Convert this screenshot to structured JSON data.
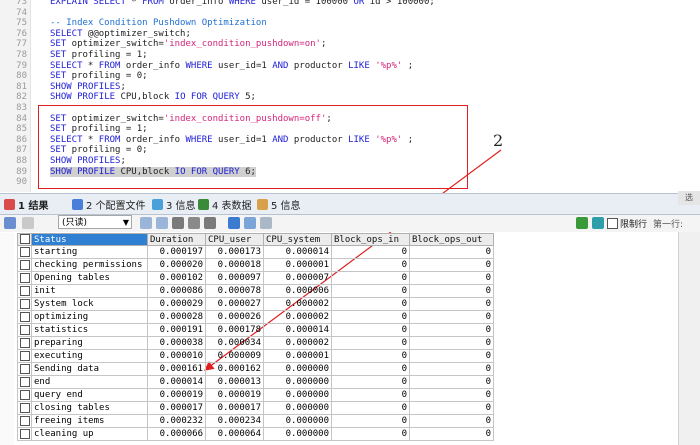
{
  "editor": {
    "lines": [
      {
        "n": "73",
        "code": "EXPLAIN SELECT * FROM order_info WHERE user_id = 100000 OR id > 100000;"
      },
      {
        "n": "74",
        "code": ""
      },
      {
        "n": "75",
        "code": "-- Index Condition Pushdown Optimization"
      },
      {
        "n": "76",
        "code": "SELECT @@optimizer_switch;"
      },
      {
        "n": "77",
        "code": "SET optimizer_switch='index_condition_pushdown=on';"
      },
      {
        "n": "78",
        "code": "SET profiling = 1;"
      },
      {
        "n": "79",
        "code": "SELECT * FROM order_info WHERE user_id=1 AND productor LIKE '%p%' ;"
      },
      {
        "n": "80",
        "code": "SET profiling = 0;"
      },
      {
        "n": "81",
        "code": "SHOW PROFILES;"
      },
      {
        "n": "82",
        "code": "SHOW PROFILE CPU,block IO FOR QUERY 5;"
      },
      {
        "n": "83",
        "code": ""
      },
      {
        "n": "84",
        "code": "SET optimizer_switch='index_condition_pushdown=off';"
      },
      {
        "n": "85",
        "code": "SET profiling = 1;"
      },
      {
        "n": "86",
        "code": "SELECT * FROM order_info WHERE user_id=1 AND productor LIKE '%p%' ;"
      },
      {
        "n": "87",
        "code": "SET profiling = 0;"
      },
      {
        "n": "88",
        "code": "SHOW PROFILES;"
      },
      {
        "n": "89",
        "code": "SHOW PROFILE CPU,block IO FOR QUERY 6;"
      },
      {
        "n": "90",
        "code": ""
      }
    ],
    "callout_label": "2"
  },
  "tabs": [
    {
      "label": "1 结果",
      "color": "#d94a4a"
    },
    {
      "label": "2 个配置文件",
      "color": "#4a7fd9"
    },
    {
      "label": "3 信息",
      "color": "#4aa0d9"
    },
    {
      "label": "4 表数据",
      "color": "#3a8a3a"
    },
    {
      "label": "5 信息",
      "color": "#d9a04a"
    }
  ],
  "toolbar": {
    "mode_value": "(只读)",
    "limit_label": "限制行",
    "first_row_label": "第一行:",
    "right_corner_text": "选"
  },
  "grid": {
    "columns": [
      "Status",
      "Duration",
      "CPU_user",
      "CPU_system",
      "Block_ops_in",
      "Block_ops_out"
    ],
    "rows": [
      [
        "starting",
        "0.000197",
        "0.000173",
        "0.000014",
        "0",
        "0"
      ],
      [
        "checking permissions",
        "0.000020",
        "0.000018",
        "0.000001",
        "0",
        "0"
      ],
      [
        "Opening tables",
        "0.000102",
        "0.000097",
        "0.000007",
        "0",
        "0"
      ],
      [
        "init",
        "0.000086",
        "0.000078",
        "0.000006",
        "0",
        "0"
      ],
      [
        "System lock",
        "0.000029",
        "0.000027",
        "0.000002",
        "0",
        "0"
      ],
      [
        "optimizing",
        "0.000028",
        "0.000026",
        "0.000002",
        "0",
        "0"
      ],
      [
        "statistics",
        "0.000191",
        "0.000178",
        "0.000014",
        "0",
        "0"
      ],
      [
        "preparing",
        "0.000038",
        "0.000034",
        "0.000002",
        "0",
        "0"
      ],
      [
        "executing",
        "0.000010",
        "0.000009",
        "0.000001",
        "0",
        "0"
      ],
      [
        "Sending data",
        "0.000161",
        "0.000162",
        "0.000000",
        "0",
        "0"
      ],
      [
        "end",
        "0.000014",
        "0.000013",
        "0.000000",
        "0",
        "0"
      ],
      [
        "query end",
        "0.000019",
        "0.000019",
        "0.000000",
        "0",
        "0"
      ],
      [
        "closing tables",
        "0.000017",
        "0.000017",
        "0.000000",
        "0",
        "0"
      ],
      [
        "freeing items",
        "0.000232",
        "0.000234",
        "0.000000",
        "0",
        "0"
      ],
      [
        "cleaning up",
        "0.000066",
        "0.000064",
        "0.000000",
        "0",
        "0"
      ]
    ]
  }
}
